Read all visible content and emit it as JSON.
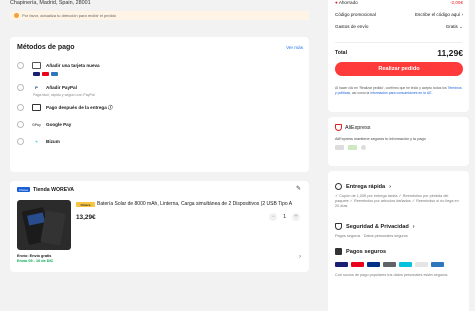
{
  "address": "Chapinería, Madrid, Spain, 28001",
  "warning": "Por favor, actualiza tu dirección para recibir el pedido",
  "payment": {
    "title": "Métodos de pago",
    "see_more": "Ver más",
    "options": [
      {
        "label": "Añadir una tarjeta nueva",
        "icon": "credit-card-icon"
      },
      {
        "label": "Añadir PayPal",
        "icon": "paypal-icon",
        "note": "Paga fácil, rápido y seguro con PayPal"
      },
      {
        "label": "Pago después de la entrega ⓘ",
        "icon": "calendar-icon"
      },
      {
        "label": "Google Pay",
        "icon": "google-pay-icon"
      },
      {
        "label": "Bizum",
        "icon": "bizum-icon"
      }
    ]
  },
  "store": {
    "badge": "Choice",
    "name": "Tienda WOREVA",
    "choice_tag": "Choice",
    "product_title": "Batería Solar de 8000 mAh, Linterna, Carga simultánea de 2 Dispositivos (2 USB Tipo A",
    "price": "13,29€",
    "qty": "1",
    "ship_label": "Envío: Envío gratis",
    "ship_date": "Envío 09 - 10 de DIC"
  },
  "summary": {
    "ahorrado_label": "Ahorrado",
    "ahorrado_value": "-2,00€",
    "promo_label": "Código promocional",
    "promo_value": "Escribe el código aquí",
    "envio_label": "Gastos de envío",
    "envio_value": "Gratis",
    "total_label": "Total",
    "total_value": "11,29€",
    "button": "Realizar pedido",
    "legal": "Al hacer clic en 'Realizar pedido', confirmo que he leído y acepto todos los",
    "legal_link1": "Términos y políticas",
    "legal_mid": ", así como la",
    "legal_link2": "información para consumidores en la UE."
  },
  "aliexpress": {
    "title": "AliExpress",
    "text": "AliExpress mantiene seguros tu información y tu pago"
  },
  "features": {
    "delivery_title": "Entrega rápida",
    "delivery_text": "✓ Cupón de 1,00€ por entrega tardía ✓ Reembolso por pérdida del paquete ✓ Reembolso por artículos dañados ✓ Reembolso si no llega en 20 días",
    "security_title": "Seguridad & Privacidad",
    "security_text": "Pagos seguros · Datos personales seguros",
    "secure_pay_title": "Pagos seguros",
    "secure_pay_text": "Con socios de pago populares tus datos personales están seguros."
  },
  "colors": {
    "accent": "#ff3a3a",
    "link": "#1a73e8",
    "green": "#00a651"
  }
}
